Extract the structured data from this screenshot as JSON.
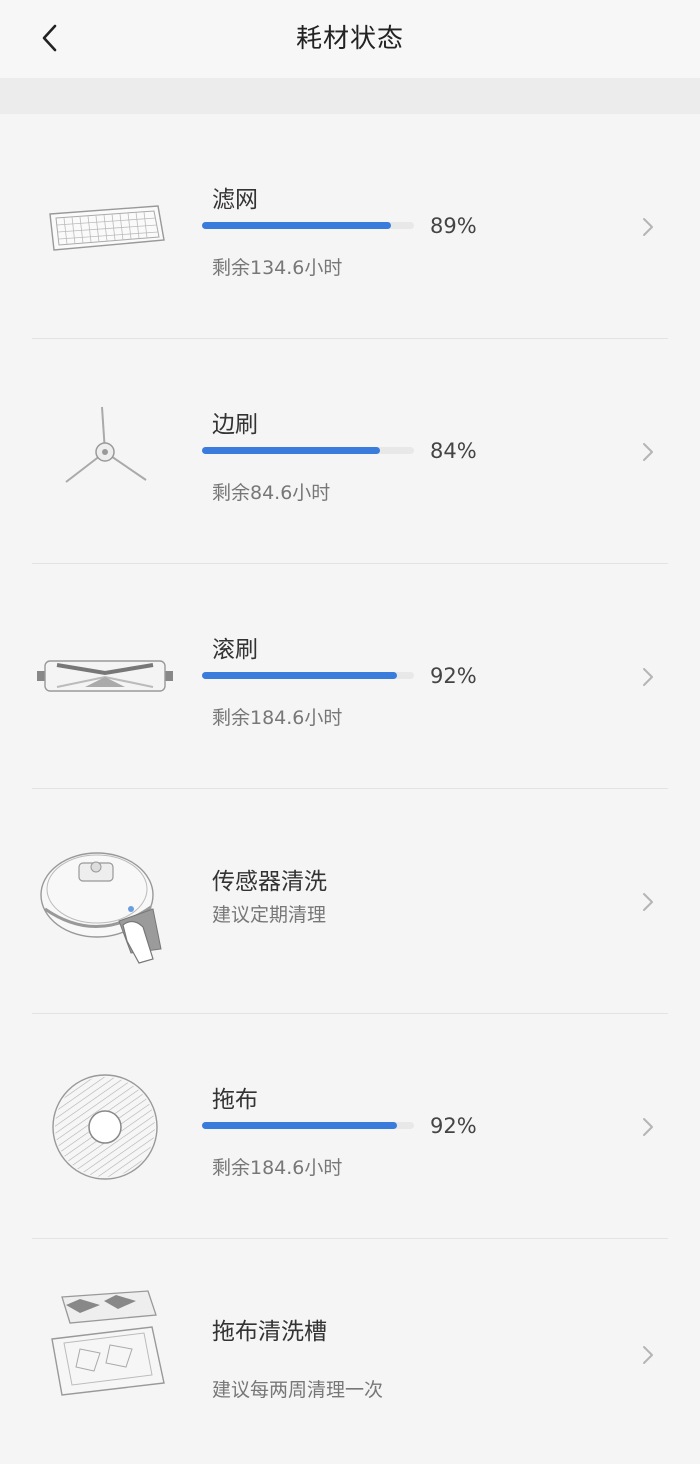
{
  "header": {
    "title": "耗材状态"
  },
  "items": [
    {
      "name": "滤网",
      "percent": 0.89,
      "percent_label": "89%",
      "remaining": "剩余134.6小时",
      "icon": "filter-icon"
    },
    {
      "name": "边刷",
      "percent": 0.84,
      "percent_label": "84%",
      "remaining": "剩余84.6小时",
      "icon": "side-brush-icon"
    },
    {
      "name": "滚刷",
      "percent": 0.92,
      "percent_label": "92%",
      "remaining": "剩余184.6小时",
      "icon": "roller-brush-icon"
    },
    {
      "name": "传感器清洗",
      "tip": "建议定期清理",
      "icon": "sensor-cleaning-icon"
    },
    {
      "name": "拖布",
      "percent": 0.92,
      "percent_label": "92%",
      "remaining": "剩余184.6小时",
      "icon": "mop-icon"
    },
    {
      "name": "拖布清洗槽",
      "tip": "建议每两周清理一次",
      "icon": "mop-tray-icon"
    }
  ],
  "colors": {
    "accent": "#3a7cdc",
    "background": "#f5f5f5"
  }
}
